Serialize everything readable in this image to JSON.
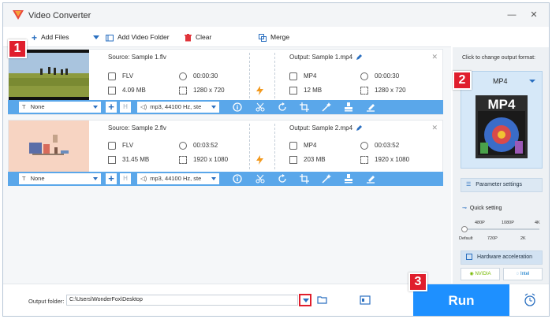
{
  "app": {
    "title": "Video Converter"
  },
  "window_controls": {
    "minimize": "—",
    "close": "✕"
  },
  "toolbar": {
    "add_files": "Add Files",
    "add_video_folder": "Add Video Folder",
    "clear": "Clear",
    "merge": "Merge"
  },
  "callouts": [
    "1",
    "2",
    "3"
  ],
  "files": [
    {
      "source_title": "Source: Sample 1.flv",
      "output_title": "Output: Sample 1.mp4",
      "src_format": "FLV",
      "src_duration": "00:00:30",
      "src_size": "4.09 MB",
      "src_resolution": "1280 x 720",
      "out_format": "MP4",
      "out_duration": "00:00:30",
      "out_size": "12 MB",
      "out_resolution": "1280 x 720",
      "subtitle": "None",
      "audio": "mp3, 44100 Hz, ste"
    },
    {
      "source_title": "Source: Sample 2.flv",
      "output_title": "Output: Sample 2.mp4",
      "src_format": "FLV",
      "src_duration": "00:03:52",
      "src_size": "31.45 MB",
      "src_resolution": "1920 x 1080",
      "out_format": "MP4",
      "out_duration": "00:03:52",
      "out_size": "203 MB",
      "out_resolution": "1920 x 1080",
      "subtitle": "None",
      "audio": "mp3, 44100 Hz, ste"
    }
  ],
  "right_panel": {
    "hint": "Click to change output format:",
    "format": "MP4",
    "format_badge": "MP4",
    "parameter_settings": "Parameter settings",
    "quick_setting": "Quick setting",
    "quality_top": [
      "480P",
      "1080P",
      "4K"
    ],
    "quality_bottom": [
      "Default",
      "720P",
      "2K"
    ],
    "hardware_acceleration": "Hardware acceleration",
    "nvidia": "NVIDIA",
    "intel": "Intel"
  },
  "bottom": {
    "output_folder_label": "Output folder:",
    "output_path": "C:\\Users\\WonderFox\\Desktop",
    "run": "Run"
  },
  "colors": {
    "accent": "#1e90ff",
    "edit_bar": "#5aa7ea",
    "callout": "#e01e2c"
  }
}
